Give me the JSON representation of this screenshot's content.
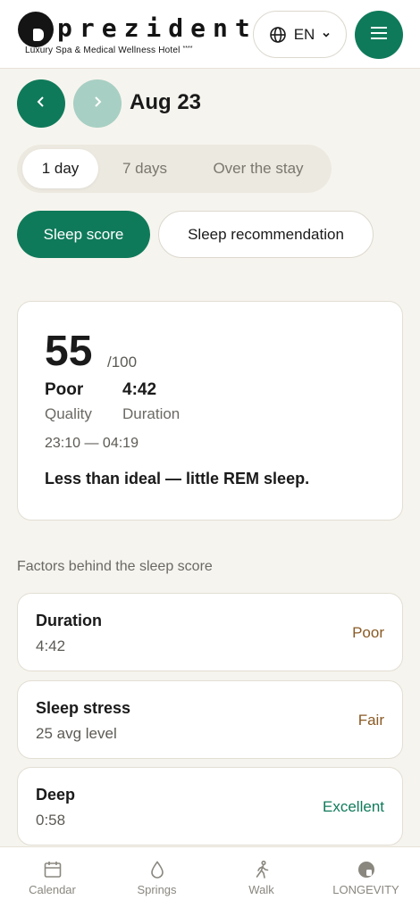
{
  "brand": {
    "name": "prezident",
    "tagline": "Luxury Spa & Medical Wellness Hotel",
    "stars": "****"
  },
  "header": {
    "language": "EN"
  },
  "date_nav": {
    "date": "Aug 23"
  },
  "period_tabs": [
    {
      "label": "1 day",
      "active": true
    },
    {
      "label": "7 days",
      "active": false
    },
    {
      "label": "Over the stay",
      "active": false
    }
  ],
  "modes": [
    {
      "label": "Sleep score",
      "active": true
    },
    {
      "label": "Sleep recommendation",
      "active": false
    }
  ],
  "score_card": {
    "score": "55",
    "max": "/100",
    "quality_value": "Poor",
    "quality_label": "Quality",
    "duration_value": "4:42",
    "duration_label": "Duration",
    "time_range": "23:10 — 04:19",
    "summary": "Less than ideal — little REM sleep."
  },
  "factors_title": "Factors behind the sleep score",
  "factors": [
    {
      "name": "Duration",
      "value": "4:42",
      "rating": "Poor",
      "rating_color": "#8a5a24"
    },
    {
      "name": "Sleep stress",
      "value": "25 avg level",
      "rating": "Fair",
      "rating_color": "#8a5a24"
    },
    {
      "name": "Deep",
      "value": "0:58",
      "rating": "Excellent",
      "rating_color": "#0f7a5a"
    }
  ],
  "bottom_nav": [
    {
      "label": "Calendar",
      "icon": "calendar-icon"
    },
    {
      "label": "Springs",
      "icon": "drop-icon"
    },
    {
      "label": "Walk",
      "icon": "walk-icon"
    },
    {
      "label": "LONGEVITY",
      "icon": "longevity-icon"
    }
  ],
  "colors": {
    "accent": "#0f7a5a",
    "accent_light": "#a8cfc3",
    "background": "#f6f4ee"
  }
}
